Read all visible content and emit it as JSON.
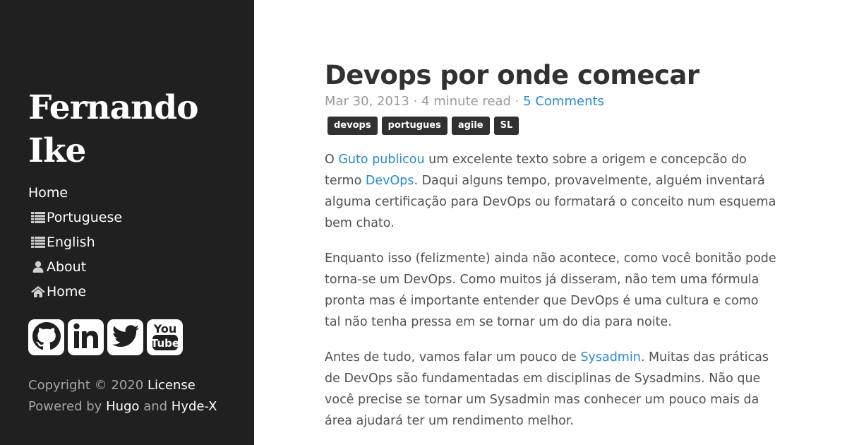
{
  "sidebar": {
    "brand_line1": "Fernando",
    "brand_line2": "Ike",
    "nav": [
      {
        "label": "Home",
        "icon": ""
      },
      {
        "label": "Portuguese",
        "icon": "list-icon"
      },
      {
        "label": "English",
        "icon": "list-icon"
      },
      {
        "label": "About",
        "icon": "user-icon"
      },
      {
        "label": "Home",
        "icon": "home-icon"
      }
    ],
    "social": [
      "github-icon",
      "linkedin-icon",
      "twitter-icon",
      "youtube-icon"
    ],
    "footer": {
      "copyright": "Copyright © 2020",
      "license": "License",
      "powered_by": "Powered by",
      "hugo": "Hugo",
      "and": "and",
      "hydex": "Hyde-X"
    }
  },
  "post": {
    "title": "Devops por onde comecar",
    "date": "Mar 30, 2013",
    "read_time": "4 minute read",
    "separator": "·",
    "comments": "5 Comments",
    "tags": [
      "devops",
      "portugues",
      "agile",
      "SL"
    ],
    "p1": {
      "a": "O ",
      "link1": "Guto publicou",
      "b": " um excelente texto sobre a origem e concepcão do termo ",
      "link2": "DevOps",
      "c": ". Daqui alguns tempo, provavelmente, alguém inventará alguma certificação para DevOps ou formatará o conceito num esquema bem chato."
    },
    "p2": "Enquanto isso (felizmente) ainda não acontece, como você bonitão pode torna-se um DevOps. Como muitos já disseram, não tem uma fórmula pronta mas é importante entender que DevOps é uma cultura e como tal não tenha pressa em se tornar um do dia para noite.",
    "p3": {
      "a": "Antes de tudo, vamos falar um pouco de ",
      "link": "Sysadmin",
      "b": ". Muitas das práticas de DevOps são fundamentadas em disciplinas de Sysadmins. Não que você precise se tornar um Sysadmin mas conhecer um pouco mais da área ajudará ter um rendimento melhor."
    }
  },
  "colors": {
    "sidebar_bg": "#202020",
    "link": "#268bd2",
    "tag_bg": "#313131",
    "text": "#515151"
  }
}
